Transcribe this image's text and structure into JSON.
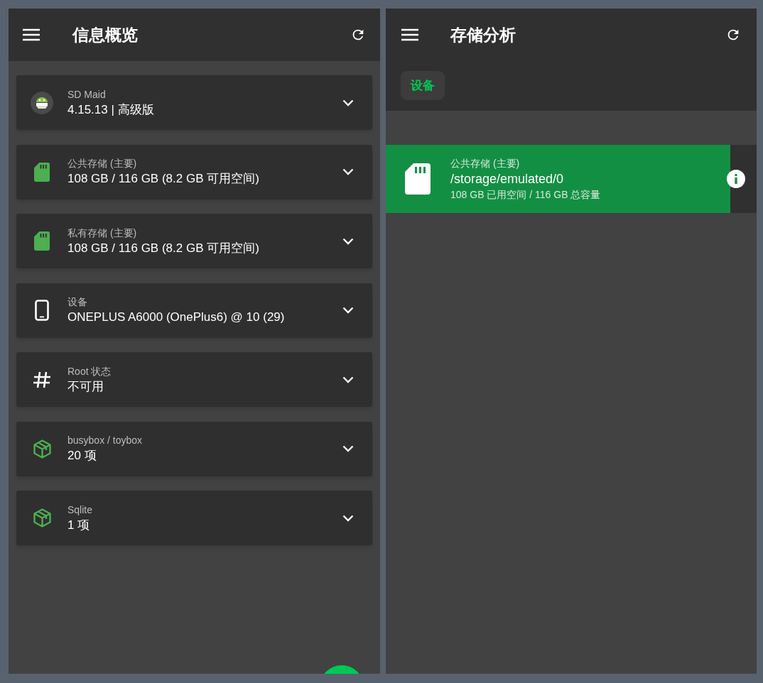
{
  "overview": {
    "title": "信息概览",
    "cards": [
      {
        "kind": "app",
        "label": "SD Maid",
        "value": "4.15.13 | 高级版"
      },
      {
        "kind": "sdcard",
        "label": "公共存储 (主要)",
        "value": "108 GB / 116 GB (8.2 GB 可用空间)"
      },
      {
        "kind": "sdcard",
        "label": "私有存储 (主要)",
        "value": "108 GB / 116 GB (8.2 GB 可用空间)"
      },
      {
        "kind": "phone",
        "label": "设备",
        "value": "ONEPLUS A6000 (OnePlus6) @ 10 (29)"
      },
      {
        "kind": "hash",
        "label": "Root 状态",
        "value": "不可用"
      },
      {
        "kind": "package",
        "label": "busybox / toybox",
        "value": "20 项"
      },
      {
        "kind": "package",
        "label": "Sqlite",
        "value": "1 项"
      }
    ]
  },
  "storage_analysis": {
    "title": "存储分析",
    "chip": {
      "label": "设备"
    },
    "storage": {
      "label": "公共存储 (主要)",
      "path": "/storage/emulated/0",
      "summary": "108 GB 已用空间 / 116 GB 总容量",
      "level": 0.93
    }
  }
}
